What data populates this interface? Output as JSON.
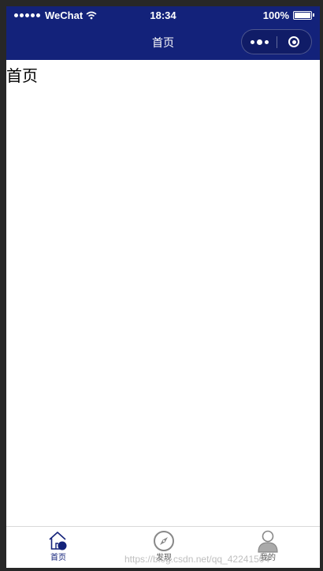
{
  "status_bar": {
    "carrier": "WeChat",
    "time": "18:34",
    "battery": "100%"
  },
  "nav_bar": {
    "title": "首页"
  },
  "main": {
    "text": "首页"
  },
  "tab_bar": {
    "items": [
      {
        "label": "首页",
        "icon": "home-icon",
        "active": true
      },
      {
        "label": "发现",
        "icon": "compass-icon",
        "active": false
      },
      {
        "label": "我的",
        "icon": "user-icon",
        "active": false
      }
    ]
  },
  "watermark": "https://blog.csdn.net/qq_42241504",
  "colors": {
    "nav_background": "#13227a",
    "active_tab": "#13227a",
    "inactive_tab": "#888888"
  }
}
